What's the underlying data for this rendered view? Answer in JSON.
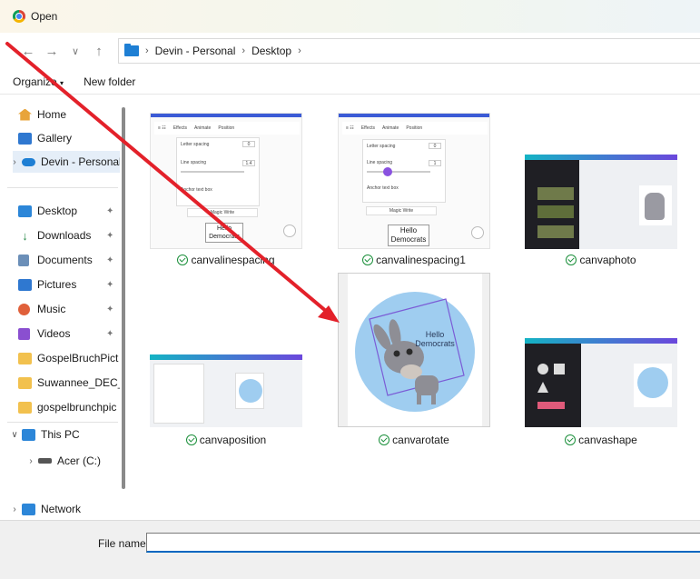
{
  "window": {
    "title": "Open"
  },
  "nav": {
    "breadcrumb": [
      "Devin - Personal",
      "Desktop"
    ]
  },
  "command_bar": {
    "organize": "Organize",
    "new_folder": "New folder"
  },
  "sidebar": {
    "items": [
      {
        "label": "Home",
        "icon": "home-icon",
        "color": "#e8a43a"
      },
      {
        "label": "Gallery",
        "icon": "gallery-icon",
        "color": "#2f78d0"
      },
      {
        "label": "Devin - Personal",
        "icon": "cloud-icon",
        "color": "#1e7fd4"
      },
      {
        "label": "Desktop",
        "icon": "desktop-folder-icon",
        "color": "#2c86d8"
      },
      {
        "label": "Downloads",
        "icon": "download-icon",
        "color": "#2a8a4a"
      },
      {
        "label": "Documents",
        "icon": "documents-icon",
        "color": "#6b8fb8"
      },
      {
        "label": "Pictures",
        "icon": "pictures-icon",
        "color": "#2f78d0"
      },
      {
        "label": "Music",
        "icon": "music-icon",
        "color": "#e0603a"
      },
      {
        "label": "Videos",
        "icon": "videos-icon",
        "color": "#8a4fd0"
      },
      {
        "label": "GospelBruchPict",
        "icon": "folder-icon",
        "color": "#f2c14e"
      },
      {
        "label": "Suwannee_DEC_",
        "icon": "folder-icon",
        "color": "#f2c14e"
      },
      {
        "label": "gospelbrunchpic",
        "icon": "folder-icon",
        "color": "#f2c14e"
      },
      {
        "label": "This PC",
        "icon": "pc-icon",
        "color": "#2c86d8"
      },
      {
        "label": "Acer (C:)",
        "icon": "drive-icon",
        "color": "#555555"
      },
      {
        "label": "Network",
        "icon": "network-icon",
        "color": "#2c86d8"
      }
    ]
  },
  "files": [
    {
      "name": "canvalinespacing"
    },
    {
      "name": "canvalinespacing1"
    },
    {
      "name": "canvaphoto"
    },
    {
      "name": "canvaposition"
    },
    {
      "name": "canvarotate"
    },
    {
      "name": "canvashape"
    }
  ],
  "previews": {
    "toolbar_effects": "Effects",
    "toolbar_animate": "Animate",
    "toolbar_position": "Position",
    "letter_spacing": "Letter spacing",
    "line_spacing": "Line spacing",
    "anchor_text_box": "Anchor text box",
    "magic_write": "Magic Write",
    "hello_democrats_line1": "Hello",
    "hello_democrats_line2": "Democrats",
    "ls_value1": "0",
    "ls_value2": "1.4",
    "ls1_value1": "0",
    "ls1_value2": "1"
  },
  "bottom": {
    "file_name_label": "File name:",
    "file_name_value": ""
  },
  "colors": {
    "accent": "#0067c0",
    "arrow": "#e3212a",
    "circle": "#9fcdf0"
  }
}
